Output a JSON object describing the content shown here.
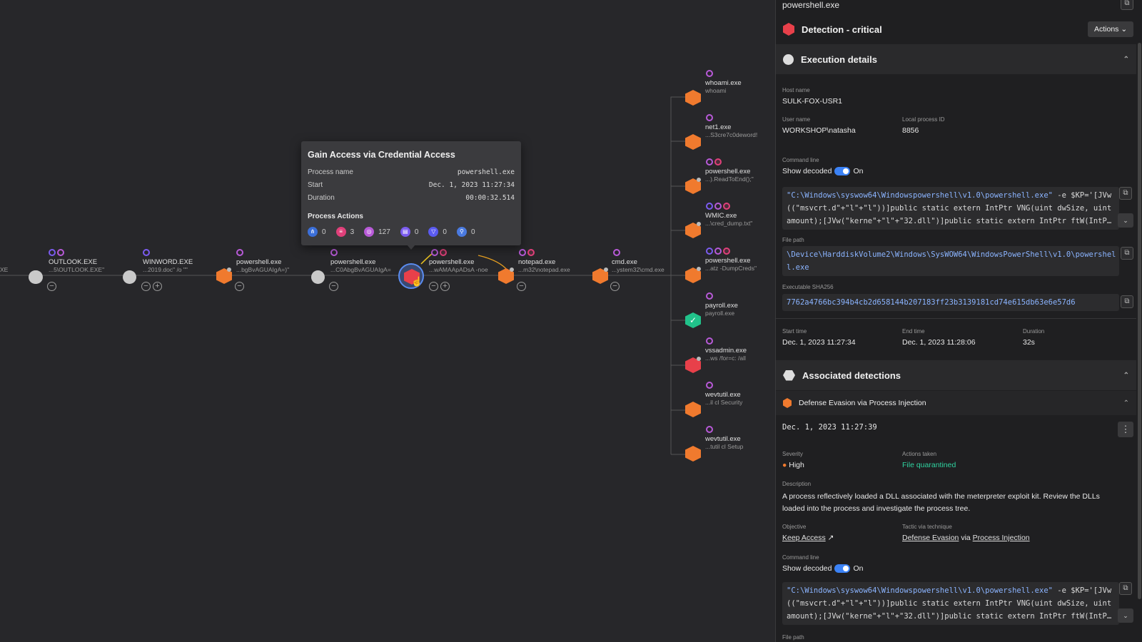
{
  "graph": {
    "chain": [
      {
        "name": "E",
        "sub": "XE"
      },
      {
        "name": "OUTLOOK.EXE",
        "sub": "...5\\OUTLOOK.EXE\""
      },
      {
        "name": "WINWORD.EXE",
        "sub": "...2019.doc\" /o \"\""
      },
      {
        "name": "powershell.exe",
        "sub": "...bgBvAGUAIgA=)\""
      },
      {
        "name": "powershell.exe",
        "sub": "...C0AbgBvAGUAIgA="
      },
      {
        "name": "powershell.exe",
        "sub": "...wAMAApADsA -noe"
      },
      {
        "name": "notepad.exe",
        "sub": "...m32\\notepad.exe"
      },
      {
        "name": "cmd.exe",
        "sub": "...ystem32\\cmd.exe"
      }
    ],
    "children": [
      {
        "name": "whoami.exe",
        "sub": "whoami"
      },
      {
        "name": "net1.exe",
        "sub": "...S3cre7c0deword!"
      },
      {
        "name": "powershell.exe",
        "sub": "...).ReadToEnd();\""
      },
      {
        "name": "WMIC.exe",
        "sub": "...\\cred_dump.txt\""
      },
      {
        "name": "powershell.exe",
        "sub": "...atz -DumpCreds\""
      },
      {
        "name": "payroll.exe",
        "sub": "payroll.exe"
      },
      {
        "name": "vssadmin.exe",
        "sub": "...ws /for=c: /all"
      },
      {
        "name": "wevtutil.exe",
        "sub": "...il  cl Security"
      },
      {
        "name": "wevtutil.exe",
        "sub": "...tutil  cl Setup"
      }
    ]
  },
  "tooltip": {
    "title": "Gain Access via Credential Access",
    "rows": [
      {
        "label": "Process name",
        "value": "powershell.exe"
      },
      {
        "label": "Start",
        "value": "Dec. 1, 2023 11:27:34"
      },
      {
        "label": "Duration",
        "value": "00:00:32.514"
      }
    ],
    "actions_title": "Process Actions",
    "actions": [
      "0",
      "3",
      "127",
      "0",
      "0",
      "0"
    ]
  },
  "panel": {
    "title": "powershell.exe",
    "detection_title": "Detection - critical",
    "actions_button": "Actions",
    "exec_title": "Execution details",
    "host_label": "Host name",
    "host": "SULK-FOX-USR1",
    "user_label": "User name",
    "user": "WORKSHOP\\natasha",
    "pid_label": "Local process ID",
    "pid": "8856",
    "cmd_label": "Command line",
    "show_decoded": "Show decoded",
    "on": "On",
    "cmd1_path": "\"C:\\Windows\\syswow64\\Windowspowershell\\v1.0\\powershell.exe\"",
    "cmd1_rest": " -e $KP='[JVw",
    "cmd_line2": "((\"msvcrt.d\"+\"l\"+\"l\"))]public static extern IntPtr VNG(uint dwSize, uint",
    "cmd_line3": "amount);[JVw(\"kerne\"+\"l\"+\"32.dll\")]public static extern IntPtr ftW(IntP…",
    "file_label": "File path",
    "file1": "\\Device\\HarddiskVolume2\\Windows\\SysWOW64\\WindowsPowerShell\\v1.0\\powershel",
    "file2": "l.exe",
    "sha_label": "Executable SHA256",
    "sha": "7762a4766bc394b4cb2d658144b207183ff23b3139181cd74e615db63e6e57d6",
    "start_label": "Start time",
    "start": "Dec. 1, 2023 11:27:34",
    "end_label": "End time",
    "end": "Dec. 1, 2023 11:28:06",
    "dur_label": "Duration",
    "dur": "32s",
    "assoc_title": "Associated detections",
    "det_name": "Defense Evasion via Process Injection",
    "det_time": "Dec. 1, 2023 11:27:39",
    "sev_label": "Severity",
    "sev": "High",
    "taken_label": "Actions taken",
    "taken": "File quarantined",
    "desc_label": "Description",
    "desc": "A process reflectively loaded a DLL associated with the meterpreter exploit kit. Review the DLLs loaded into the process and investigate the process tree.",
    "obj_label": "Objective",
    "obj": "Keep Access",
    "tac_label": "Tactic via technique",
    "tac1": "Defense Evasion",
    "via": "via",
    "tac2": "Process Injection",
    "cmd2_label": "Command line",
    "file_label2": "File path"
  },
  "colors": {
    "orange": "#f07a2e",
    "red": "#e8404a",
    "green": "#21c28a",
    "link": "#8bb4ff",
    "success": "#2fd3a0"
  }
}
